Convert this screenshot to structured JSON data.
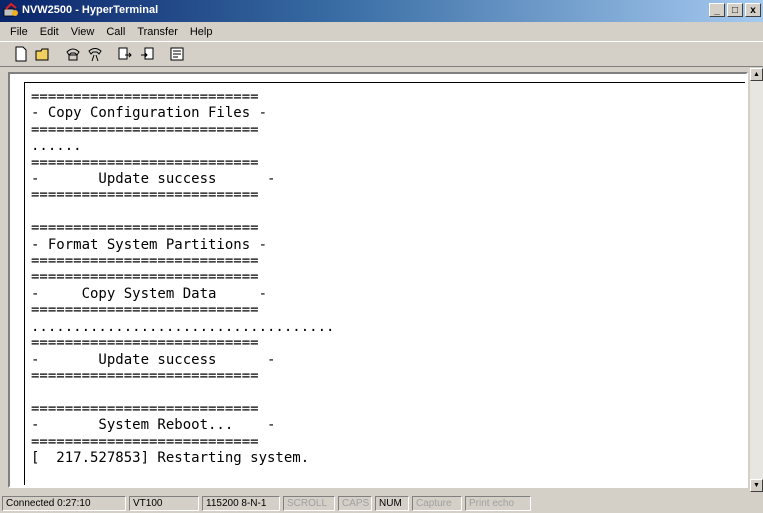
{
  "window": {
    "title": "NVW2500 - HyperTerminal",
    "icon": "hyperterminal-icon"
  },
  "menu": [
    "File",
    "Edit",
    "View",
    "Call",
    "Transfer",
    "Help"
  ],
  "toolbar": [
    "new-icon",
    "open-icon",
    "connect-icon",
    "disconnect-icon",
    "send-icon",
    "receive-icon",
    "properties-icon"
  ],
  "terminal": {
    "text": "===========================\n- Copy Configuration Files -\n===========================\n......\n===========================\n-       Update success      -\n===========================\n\n===========================\n- Format System Partitions -\n===========================\n===========================\n-     Copy System Data     -\n===========================\n....................................\n===========================\n-       Update success      -\n===========================\n\n===========================\n-       System Reboot...    -\n===========================\n[  217.527853] Restarting system."
  },
  "status": {
    "connected": "Connected 0:27:10",
    "emulation": "VT100",
    "settings": "115200 8-N-1",
    "scroll": "SCROLL",
    "caps": "CAPS",
    "num": "NUM",
    "capture": "Capture",
    "print_echo": "Print echo"
  }
}
